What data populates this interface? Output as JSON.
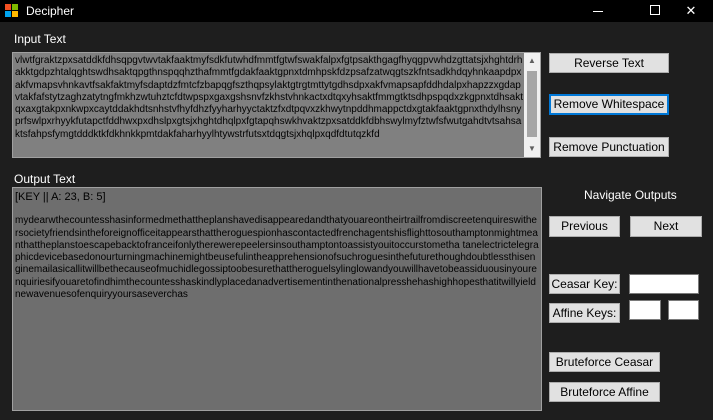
{
  "window": {
    "title": "Decipher",
    "icon": "app-icon",
    "controls": {
      "minimize": "minimize-icon",
      "maximize": "maximize-icon",
      "close": "✕"
    }
  },
  "input": {
    "label": "Input Text",
    "text": "vlwtfgraktzpxsatddkfdhsqpgvtwvtakfaaktmyfsdkfutwhdfmmtfgtwfswakfalpxfgtpsakthgagfhyqgpvwhdzgttatsjxhghtdrhakktgdpzhtalqghtswdhsaktqpgthnspqqhzthafmmtfgdakfaaktgpnxtdmhpskfdzpsafzatwqgtszkfntsadkhdqyhnkaapdpxakfvmapsvhnkavtfsakfaktmyfsdaptdzfmtcfzbapqgfszthqpsylaktgtrgtmttytgdhsdpxakfvmapsapfddhdalpxhapzzxgdapvtakfafstytzaghzatytngfmkhzwtuhztcfdtwpspxgaxgshsnvfzkhstvhnkactxdtqxyhsaktfmmgtktsdhpspqdxzkgpnxtdhsaktqxaxgtakpxnkwpxcaytddakhdtsnhstvfhyfdhzfyyharhyyctaktzfxdtpqvxzkhwytnpddhmappctdxgtakfaaktgpnxthdylhsnyprfswlpxrhyykfutapctfddhwxpxdhslpxgtsjxhghtdhqlpxfgtapqhswkhvaktzpxsatddkfdbhswylmyfztwfsfwutgahdtvtsahsaktsfahpsfymgtdddktkfdkhnkkpmtdakfaharhyylhtywstrfutsxtdqgtsjxhqlpxqdfdtutqzkfd"
  },
  "output": {
    "label": "Output Text",
    "key_line": "[KEY || A: 23, B: 5]",
    "text": "mydearwthecountesshasinformedmethattheplanshavedisappearedandthatyouareontheirtrailfromdiscreetenquireswithersocietyfriendsintheforeignofficeitappearsthattheroguespionhascontactedfrenchagentshisflighttosouthamptonmightmeanthattheplanstoescapebacktofranceifonlytherewerepeelersinsouthamptontoassistyouitoccurstometha tanelectrictelegraphicdevicebasedonourturningmachinemightbeusefulintheapprehensionofsuchroguesinthefuturethoughdoubtlessthisenginemailasicallitwillbethecauseofmuchidlegossiptoobesurethattheroguelsylinglowandyouwillhavetobeassiduousinyourenquiriesifyouaretofindhimthecountesshaskindlyplacedanadvertisementinthenationalpresshehashighhopesthatitwillyieldnewavenuesofenquiryyoursaseverchas"
  },
  "buttons": {
    "reverse": "Reverse Text",
    "remove_whitespace": "Remove Whitespace",
    "remove_punctuation": "Remove Punctuation",
    "previous": "Previous",
    "next": "Next",
    "bruteforce_ceasar": "Bruteforce Ceasar",
    "bruteforce_affine": "Bruteforce Affine"
  },
  "navigate": {
    "label": "Navigate Outputs"
  },
  "keys": {
    "ceasar_label": "Ceasar Key:",
    "affine_label": "Affine Keys:",
    "ceasar_value": "",
    "affine_a": "",
    "affine_b": ""
  },
  "colors": {
    "background": "#1e1e1e",
    "titlebar": "#000000",
    "input_bg": "#808080",
    "output_bg": "#6e6e6e",
    "button_bg": "#e1e1e1",
    "focus_border": "#0078d7"
  }
}
